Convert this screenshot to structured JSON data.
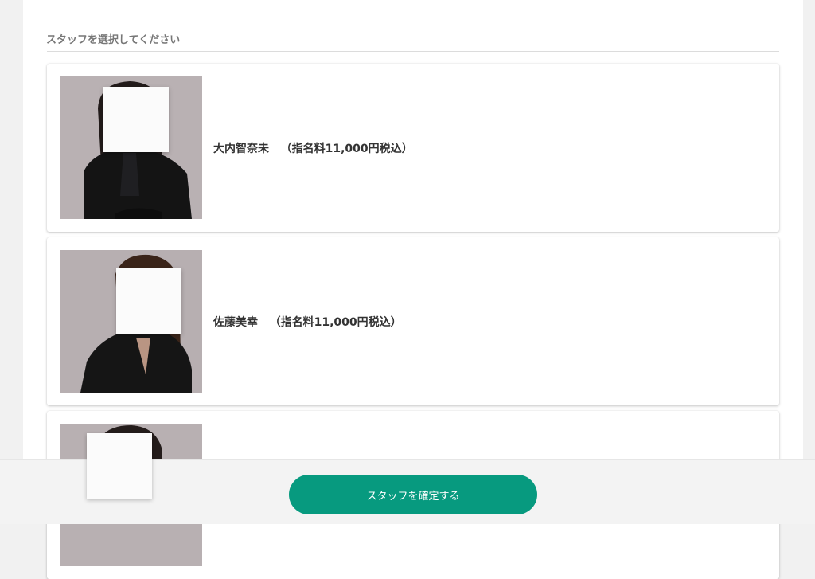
{
  "section": {
    "title": "スタッフを選択してください"
  },
  "staff": [
    {
      "name": "大内智奈未",
      "fee": "（指名料11,000円税込）"
    },
    {
      "name": "佐藤美幸",
      "fee": "（指名料11,000円税込）"
    },
    {
      "name": "",
      "fee": ""
    }
  ],
  "footer": {
    "confirm_label": "スタッフを確定する"
  },
  "colors": {
    "accent": "#079a7f",
    "background": "#f1f1f1"
  }
}
